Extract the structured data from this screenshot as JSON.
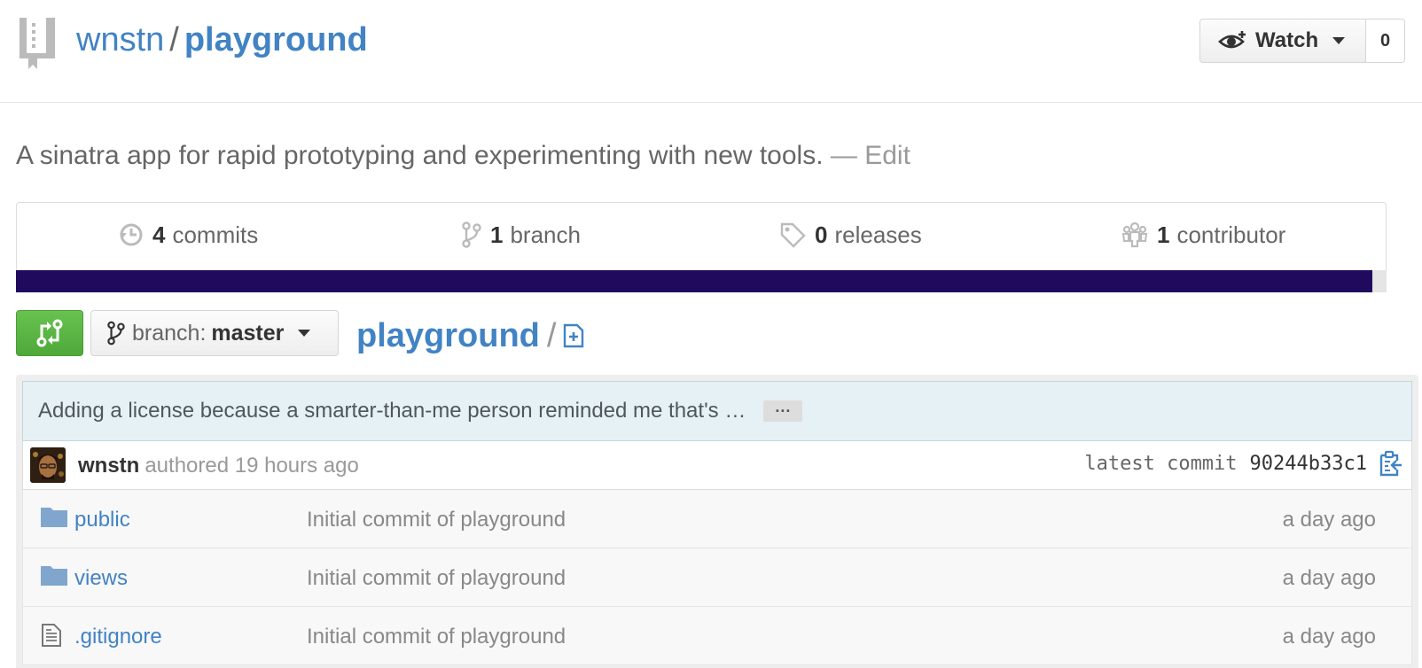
{
  "header": {
    "owner": "wnstn",
    "separator": "/",
    "repo": "playground",
    "watch_label": "Watch",
    "watch_count": "0"
  },
  "description": {
    "text": "A sinatra app for rapid prototyping and experimenting with new tools.",
    "edit": "— Edit"
  },
  "summary": [
    {
      "count": "4",
      "label": "commits",
      "icon": "history-icon"
    },
    {
      "count": "1",
      "label": "branch",
      "icon": "git-branch-icon"
    },
    {
      "count": "0",
      "label": "releases",
      "icon": "tag-icon"
    },
    {
      "count": "1",
      "label": "contributor",
      "icon": "organization-icon"
    }
  ],
  "language_bar_color": "#1f0a5e",
  "file_nav": {
    "branch_prefix": "branch:",
    "branch_name": "master",
    "breadcrumb_root": "playground",
    "breadcrumb_sep": "/"
  },
  "commit": {
    "message": "Adding a license because a smarter-than-me person reminded me that's …",
    "ellipsis": "···",
    "author": "wnstn",
    "authored": "authored 19 hours ago",
    "latest_label": "latest commit",
    "sha": "90244b33c1"
  },
  "files": [
    {
      "type": "directory",
      "name": "public",
      "message": "Initial commit of playground",
      "age": "a day ago"
    },
    {
      "type": "directory",
      "name": "views",
      "message": "Initial commit of playground",
      "age": "a day ago"
    },
    {
      "type": "file",
      "name": ".gitignore",
      "message": "Initial commit of playground",
      "age": "a day ago"
    }
  ],
  "colors": {
    "link": "#4183c4",
    "compare_button": "#5cb746"
  }
}
